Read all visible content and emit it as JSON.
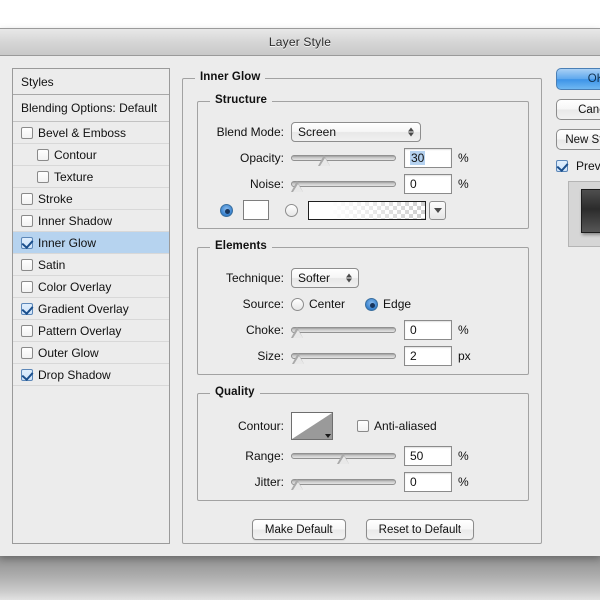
{
  "window": {
    "title": "Layer Style"
  },
  "styles_panel": {
    "header": "Styles",
    "blending_options": "Blending Options: Default",
    "items": [
      {
        "label": "Bevel & Emboss",
        "checked": false,
        "indent": false,
        "selected": false
      },
      {
        "label": "Contour",
        "checked": false,
        "indent": true,
        "selected": false
      },
      {
        "label": "Texture",
        "checked": false,
        "indent": true,
        "selected": false
      },
      {
        "label": "Stroke",
        "checked": false,
        "indent": false,
        "selected": false
      },
      {
        "label": "Inner Shadow",
        "checked": false,
        "indent": false,
        "selected": false
      },
      {
        "label": "Inner Glow",
        "checked": true,
        "indent": false,
        "selected": true
      },
      {
        "label": "Satin",
        "checked": false,
        "indent": false,
        "selected": false
      },
      {
        "label": "Color Overlay",
        "checked": false,
        "indent": false,
        "selected": false
      },
      {
        "label": "Gradient Overlay",
        "checked": true,
        "indent": false,
        "selected": false
      },
      {
        "label": "Pattern Overlay",
        "checked": false,
        "indent": false,
        "selected": false
      },
      {
        "label": "Outer Glow",
        "checked": false,
        "indent": false,
        "selected": false
      },
      {
        "label": "Drop Shadow",
        "checked": true,
        "indent": false,
        "selected": false
      }
    ]
  },
  "panel": {
    "title": "Inner Glow",
    "structure": {
      "title": "Structure",
      "blend_mode_label": "Blend Mode:",
      "blend_mode_value": "Screen",
      "opacity_label": "Opacity:",
      "opacity_value": "30",
      "opacity_unit": "%",
      "noise_label": "Noise:",
      "noise_value": "0",
      "noise_unit": "%",
      "fill_color_selected": true,
      "fill_gradient_selected": false,
      "color_swatch_hex": "#ffffff"
    },
    "elements": {
      "title": "Elements",
      "technique_label": "Technique:",
      "technique_value": "Softer",
      "source_label": "Source:",
      "source_center": "Center",
      "source_edge": "Edge",
      "source_selected": "Edge",
      "choke_label": "Choke:",
      "choke_value": "0",
      "choke_unit": "%",
      "size_label": "Size:",
      "size_value": "2",
      "size_unit": "px"
    },
    "quality": {
      "title": "Quality",
      "contour_label": "Contour:",
      "anti_aliased_label": "Anti-aliased",
      "anti_aliased_checked": false,
      "range_label": "Range:",
      "range_value": "50",
      "range_unit": "%",
      "jitter_label": "Jitter:",
      "jitter_value": "0",
      "jitter_unit": "%"
    },
    "buttons": {
      "make_default": "Make Default",
      "reset_to_default": "Reset to Default"
    }
  },
  "actions": {
    "ok": "OK",
    "cancel": "Cancel",
    "new_style": "New Style...",
    "preview_label": "Preview",
    "preview_checked": true
  },
  "colors": {
    "selection_blue": "#b6d3ef",
    "accent_blue": "#3c93e8",
    "dialog_bg": "#ececec"
  }
}
